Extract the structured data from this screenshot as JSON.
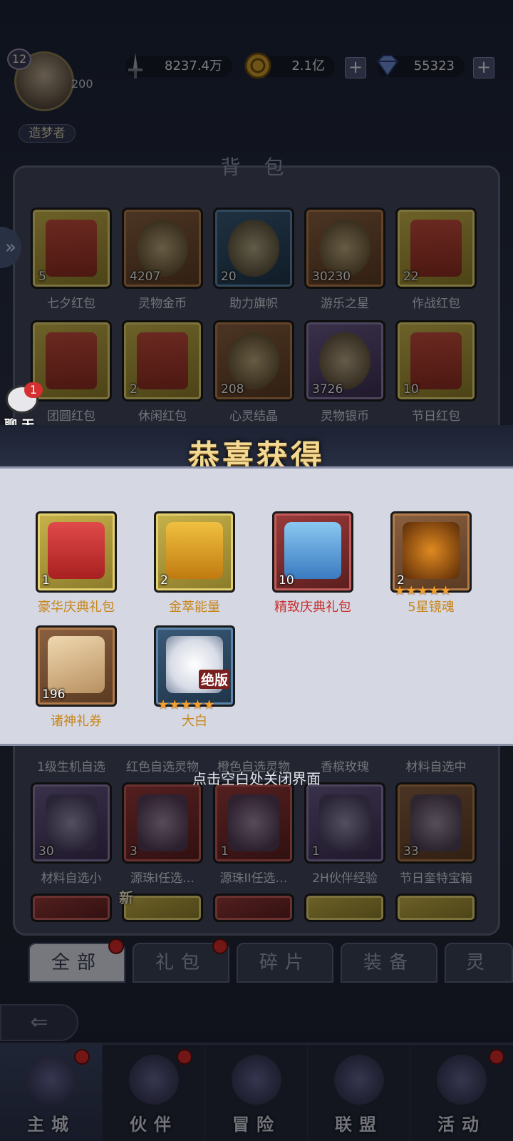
{
  "player": {
    "level": "12",
    "title": "造梦者",
    "exp": "200"
  },
  "resources": [
    {
      "name": "power",
      "icon": "sword-icon",
      "value": "8237.4万"
    },
    {
      "name": "gold",
      "icon": "coin-icon",
      "value": "2.1亿"
    },
    {
      "name": "diamond",
      "icon": "diamond-icon",
      "value": "55323"
    }
  ],
  "bag": {
    "title": "背 包",
    "items": [
      {
        "label": "七夕红包",
        "count": "5",
        "style": "gold"
      },
      {
        "label": "灵物金币",
        "count": "4207",
        "style": "brown"
      },
      {
        "label": "助力旗帜",
        "count": "20",
        "style": "blue"
      },
      {
        "label": "游乐之星",
        "count": "30230",
        "style": "brown"
      },
      {
        "label": "作战红包",
        "count": "22",
        "style": "gold"
      },
      {
        "label": "团圆红包",
        "count": "",
        "style": "gold"
      },
      {
        "label": "休闲红包",
        "count": "2",
        "style": "gold"
      },
      {
        "label": "心灵结晶",
        "count": "208",
        "style": "brown"
      },
      {
        "label": "灵物银币",
        "count": "3726",
        "style": "purple"
      },
      {
        "label": "节日红包",
        "count": "10",
        "style": "gold"
      }
    ],
    "lower_labels": [
      "1级生机自选",
      "红色自选灵物",
      "橙色自选灵物",
      "香槟玫瑰",
      "材料自选中"
    ],
    "lower_items": [
      {
        "label": "材料自选小",
        "count": "30",
        "style": "purple"
      },
      {
        "label": "源珠I任选…",
        "count": "3",
        "style": "red"
      },
      {
        "label": "源珠II任选…",
        "count": "1",
        "style": "red"
      },
      {
        "label": "2H伙伴经验",
        "count": "1",
        "style": "purple"
      },
      {
        "label": "节日奎特宝箱",
        "count": "33",
        "style": "brown"
      }
    ],
    "new_badge": "新"
  },
  "chat": {
    "label": "聊 天",
    "badge": "1"
  },
  "popup": {
    "title": "恭喜获得",
    "rewards": [
      {
        "label": "豪华庆典礼包",
        "count": "1",
        "style": "gold",
        "label_color": "#c8861a",
        "icon": "gift-box-icon"
      },
      {
        "label": "金萃能量",
        "count": "2",
        "style": "gold",
        "label_color": "#c8861a",
        "icon": "potion-tube-icon"
      },
      {
        "label": "精致庆典礼包",
        "count": "10",
        "style": "red",
        "label_color": "#c83030",
        "icon": "gift-box-blue-icon"
      },
      {
        "label": "5星镜魂",
        "count": "2",
        "style": "brown",
        "label_color": "#c8861a",
        "icon": "mirror-soul-icon",
        "stars": "★★★★★"
      },
      {
        "label": "诸神礼券",
        "count": "196",
        "style": "brown",
        "label_color": "#c8861a",
        "icon": "ticket-icon"
      },
      {
        "label": "大白",
        "count": "",
        "style": "blue",
        "label_color": "#c8861a",
        "icon": "polar-bear-icon",
        "stars": "★★★★★",
        "tag": "绝版"
      }
    ],
    "close_hint": "点击空白处关闭界面"
  },
  "tabs": [
    "全部",
    "礼包",
    "碎片",
    "装备",
    "灵"
  ],
  "nav": [
    "主城",
    "伙伴",
    "冒险",
    "联盟",
    "活动"
  ],
  "colors": {
    "gold_frame": "#c7b24a",
    "badge_red": "#d02828",
    "popup_bg": "#d5d7e2"
  }
}
